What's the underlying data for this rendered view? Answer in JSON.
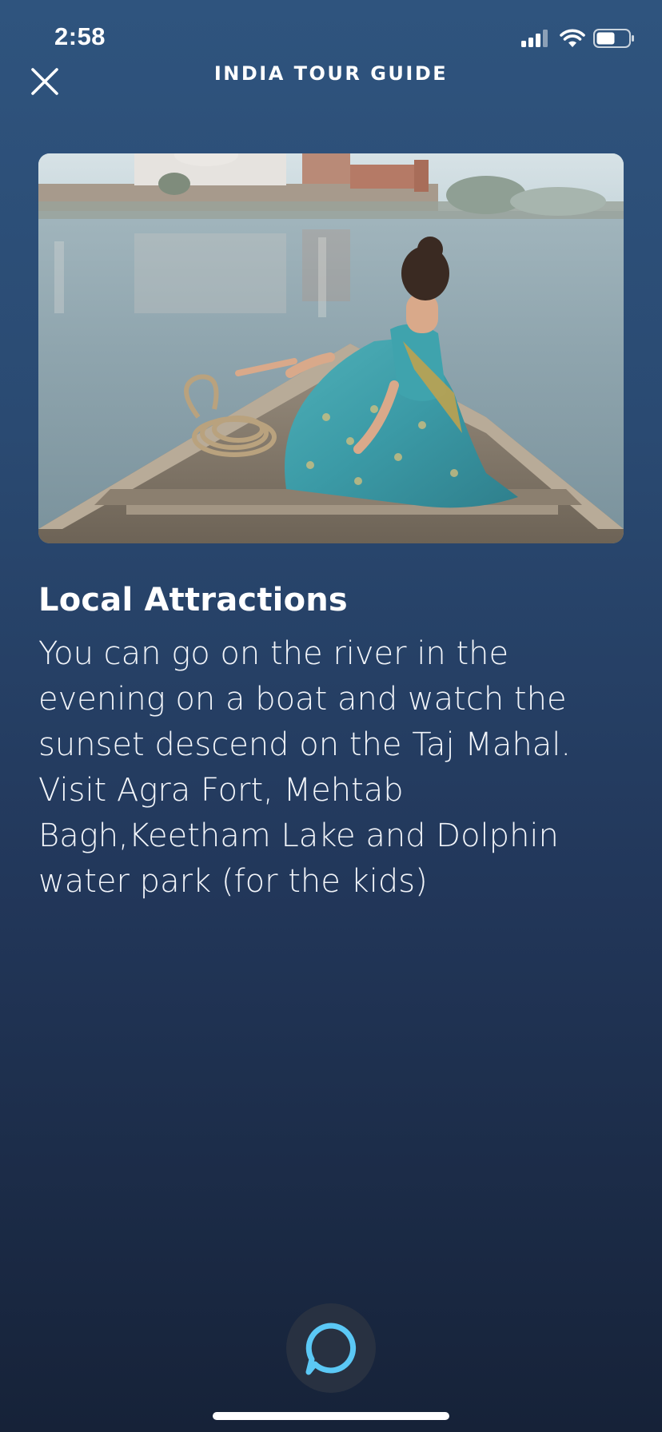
{
  "status_bar": {
    "time": "2:58"
  },
  "header": {
    "title": "INDIA TOUR GUIDE",
    "close_icon": "close-icon"
  },
  "hero_image": {
    "subject": "woman-in-sari-on-boat-on-river-with-taj-mahal-in-background"
  },
  "card": {
    "title": "Local Attractions",
    "body": "You can go on the river in the evening on a boat and watch the sunset descend on the Taj Mahal. Visit Agra Fort, Mehtab Bagh,Keetham Lake and Dolphin water park (for the kids)"
  },
  "footer": {
    "assistant_icon": "alexa-ring-icon"
  },
  "colors": {
    "background_top": "#2f547e",
    "background_bottom": "#162238",
    "alexa_ring": "#5bc8f5",
    "alexa_button_bg": "#283141"
  }
}
